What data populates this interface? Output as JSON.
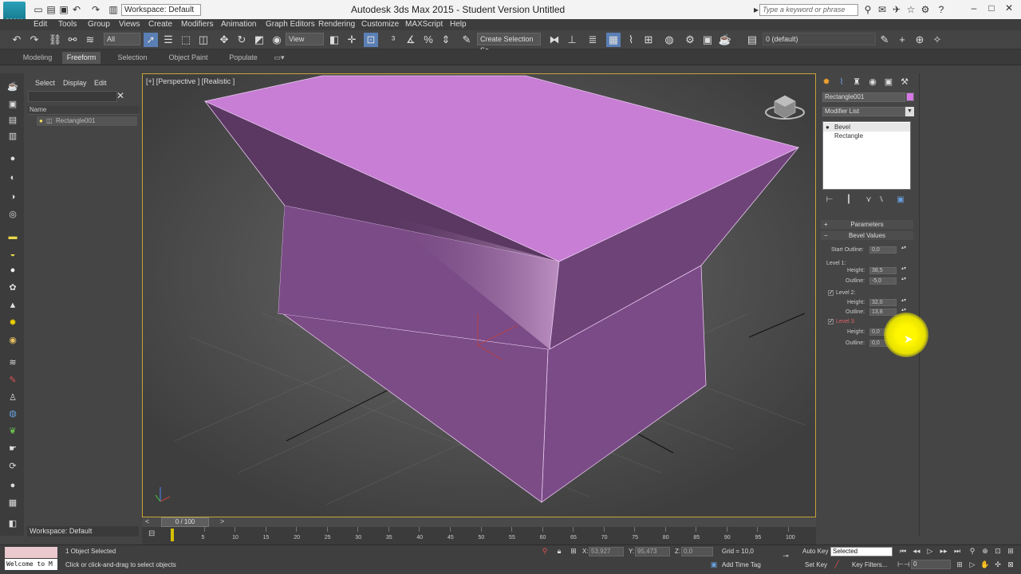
{
  "titlebar": {
    "logo_text": "MAX",
    "workspace": "Workspace: Default",
    "title": "Autodesk 3ds Max  2015   - Student Version      Untitled",
    "search_placeholder": "Type a keyword or phrase"
  },
  "menubar": {
    "items": [
      "Edit",
      "Tools",
      "Group",
      "Views",
      "Create",
      "Modifiers",
      "Animation",
      "Graph Editors",
      "Rendering",
      "Customize",
      "MAXScript",
      "Help"
    ]
  },
  "toolbar": {
    "filter": "All",
    "ref_coord": "View",
    "selection_set": "Create Selection Se",
    "layer": "0 (default)"
  },
  "ribbon": {
    "tabs": [
      "Modeling",
      "Freeform",
      "Selection",
      "Object Paint",
      "Populate"
    ],
    "active_tab": "Freeform"
  },
  "explorer": {
    "menu": [
      "Select",
      "Display",
      "Edit"
    ],
    "column_header": "Name",
    "object": "Rectangle001",
    "workspace_footer": "Workspace: Default"
  },
  "viewport": {
    "label": "[+] [Perspective ] [Realistic ]",
    "object_color": "#c77ed4"
  },
  "cmdpanel": {
    "object_name": "Rectangle001",
    "object_color": "#d678e6",
    "modifier_list": "Modifier List",
    "stack": [
      "Bevel",
      "Rectangle"
    ],
    "rollout_parameters": "Parameters",
    "rollout_bevel_values": "Bevel Values",
    "start_outline_label": "Start Outline:",
    "start_outline_value": "0,0",
    "level1_label": "Level 1:",
    "level1_height_label": "Height:",
    "level1_height": "38,5",
    "level1_outline_label": "Outline:",
    "level1_outline": "-5,0",
    "level2_label": "Level 2:",
    "level2_checked": true,
    "level2_height_label": "Height:",
    "level2_height": "32,0",
    "level2_outline_label": "Outline:",
    "level2_outline": "13,8",
    "level3_label": "Level 3:",
    "level3_checked": true,
    "level3_height_label": "Height:",
    "level3_height": "0,0",
    "level3_outline_label": "Outline:",
    "level3_outline": "0,0"
  },
  "timeline": {
    "frame_display": "0 / 100",
    "ticks": [
      "5",
      "10",
      "15",
      "20",
      "25",
      "30",
      "35",
      "40",
      "45",
      "50",
      "55",
      "60",
      "65",
      "70",
      "75",
      "80",
      "85",
      "90",
      "95",
      "100"
    ]
  },
  "statusbar": {
    "maxscript_text": "Welcome to M",
    "selection_status": "1 Object Selected",
    "prompt": "Click or click-and-drag to select objects",
    "x_label": "X:",
    "x_value": "53,927",
    "y_label": "Y:",
    "y_value": "95,473",
    "z_label": "Z:",
    "z_value": "0,0",
    "grid": "Grid = 10,0",
    "add_time_tag": "Add Time Tag",
    "auto_key": "Auto Key",
    "set_key": "Set Key",
    "key_mode": "Selected",
    "key_filters": "Key Filters...",
    "current_frame": "0"
  }
}
